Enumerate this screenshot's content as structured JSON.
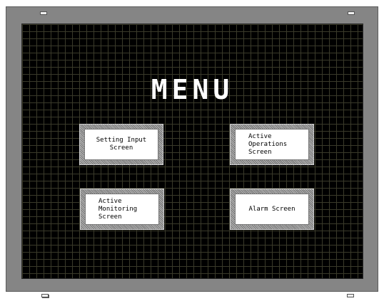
{
  "screen": {
    "title": "MENU",
    "buttons": [
      {
        "label": "Setting Input\nScreen"
      },
      {
        "label": "Active\nOperations\nScreen"
      },
      {
        "label": "Active\nMonitoring\nScreen"
      },
      {
        "label": "Alarm Screen"
      }
    ]
  },
  "colors": {
    "bezel": "#858585",
    "screen_background": "#000000",
    "grid": "#3a3a2a",
    "title": "#ffffff",
    "button_face": "#ffffff"
  }
}
